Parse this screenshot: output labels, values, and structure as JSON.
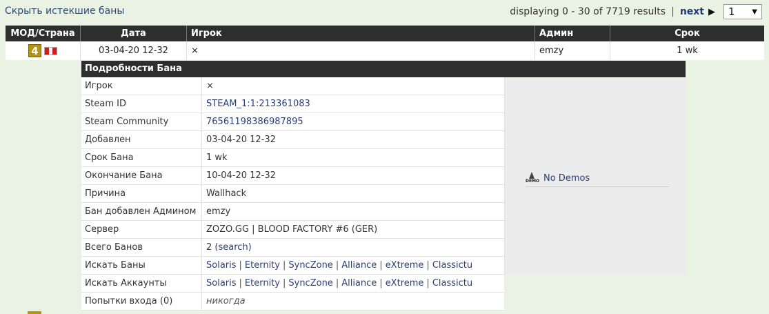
{
  "topbar": {
    "hide_expired_label": "Скрыть истекшие баны",
    "displaying_text": "displaying 0 - 30 of 7719 results",
    "separator": "|",
    "next_label": "next",
    "next_arrow": "▶",
    "page_select_value": "1"
  },
  "table": {
    "headers": {
      "mod_country": "МОД/Страна",
      "date": "Дата",
      "player": "Игрок",
      "admin": "Админ",
      "length": "Срок"
    },
    "row": {
      "mod_number": "4",
      "date": "03-04-20 12-32",
      "player": "⨯",
      "admin": "emzy",
      "length": "1 wk"
    }
  },
  "details": {
    "title": "Подробности Бана",
    "rows": [
      {
        "label": "Игрок",
        "value": "⨯"
      },
      {
        "label": "Steam ID",
        "value": "STEAM_1:1:213361083"
      },
      {
        "label": "Steam Community",
        "value": "76561198386987895"
      },
      {
        "label": "Добавлен",
        "value": "03-04-20 12-32"
      },
      {
        "label": "Срок Бана",
        "value": "1 wk"
      },
      {
        "label": "Окончание Бана",
        "value": "10-04-20 12-32"
      },
      {
        "label": "Причина",
        "value": "Wallhack"
      },
      {
        "label": "Бан добавлен Админом",
        "value": "emzy"
      },
      {
        "label": "Сервер",
        "value": "ZOZO.GG | BLOOD FACTORY #6 (GER)"
      },
      {
        "label": "Всего Банов",
        "value": "2",
        "link": "(search)"
      },
      {
        "label": "Искать Баны",
        "links": [
          "Solaris",
          "Eternity",
          "SyncZone",
          "Alliance",
          "eXtreme",
          "Classictu"
        ]
      },
      {
        "label": "Искать Аккаунты",
        "links": [
          "Solaris",
          "Eternity",
          "SyncZone",
          "Alliance",
          "eXtreme",
          "Classictu"
        ]
      },
      {
        "label": "Попытки входа (0)",
        "value": "никогда"
      }
    ],
    "demo": {
      "icon_label": "DEMO",
      "text": "No Demos"
    }
  },
  "colors": {
    "background": "#eaf3e3",
    "header": "#2e2e2e",
    "link": "#2a3f7a",
    "mod_badge": "#b8930e"
  }
}
